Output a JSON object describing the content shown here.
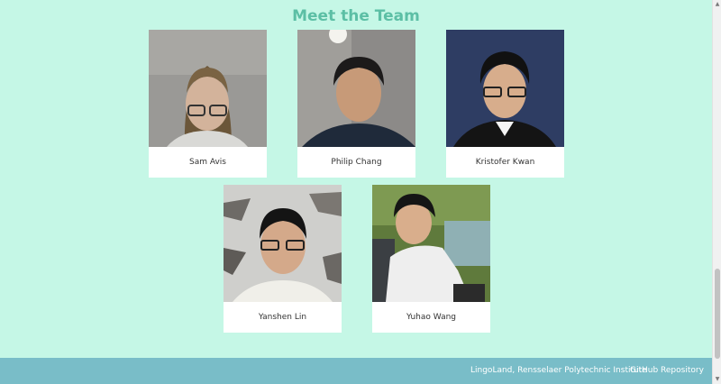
{
  "page": {
    "title": "Meet the Team"
  },
  "team": [
    {
      "name": "Sam Avis",
      "photo": "portrait-sam-avis"
    },
    {
      "name": "Philip Chang",
      "photo": "portrait-philip-chang"
    },
    {
      "name": "Kristofer Kwan",
      "photo": "portrait-kristofer-kwan"
    },
    {
      "name": "Yanshen Lin",
      "photo": "portrait-yanshen-lin"
    },
    {
      "name": "Yuhao Wang",
      "photo": "portrait-yuhao-wang"
    }
  ],
  "footer": {
    "org_link": "LingoLand, Rensselaer Polytechnic Institute",
    "repo_link": "GitHub Repository"
  },
  "colors": {
    "background": "#c5f7e6",
    "heading": "#5cbfa5",
    "footer": "#79bdc8"
  },
  "icons": {
    "scroll_up": "triangle-up-icon",
    "scroll_down": "triangle-down-icon"
  }
}
